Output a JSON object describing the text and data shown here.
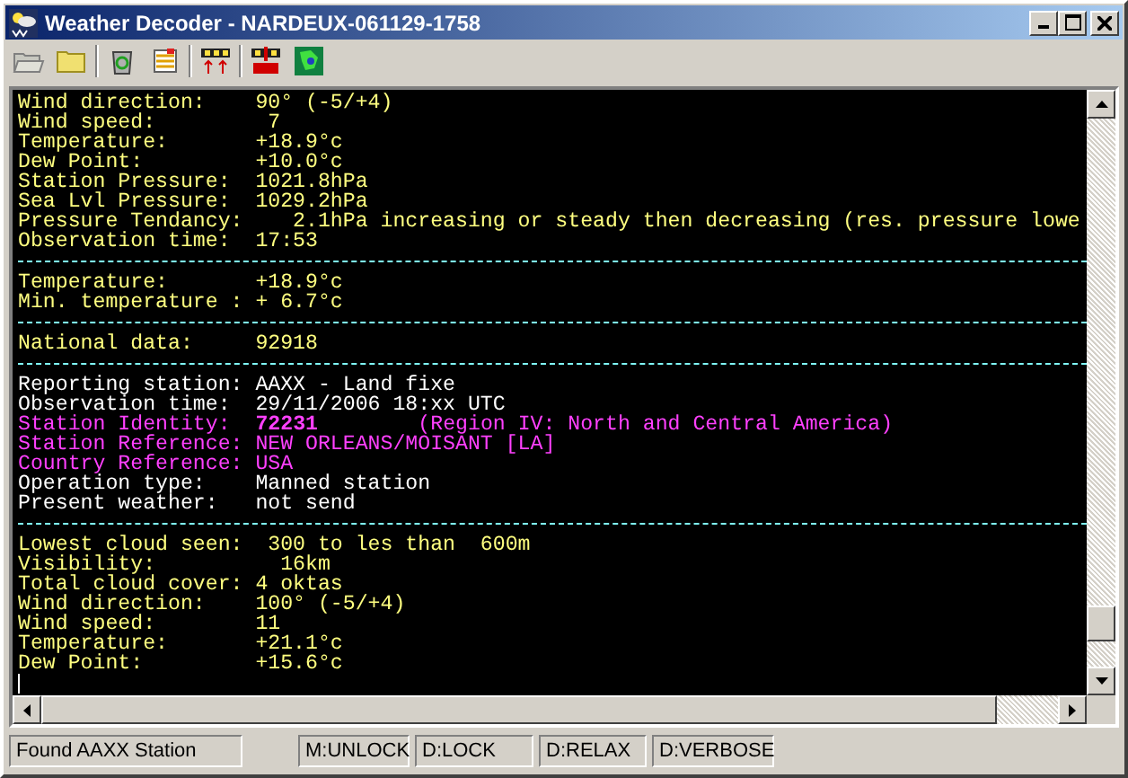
{
  "window": {
    "title": "Weather Decoder - NARDEUX-061129-1758"
  },
  "output": {
    "lines": [
      {
        "kind": "text",
        "color": "#ffff80",
        "text": "Wind direction:    90° (-5/+4)"
      },
      {
        "kind": "text",
        "color": "#ffff80",
        "text": "Wind speed:         7"
      },
      {
        "kind": "text",
        "color": "#ffff80",
        "text": "Temperature:       +18.9°c"
      },
      {
        "kind": "text",
        "color": "#ffff80",
        "text": "Dew Point:         +10.0°c"
      },
      {
        "kind": "text",
        "color": "#ffff80",
        "text": "Station Pressure:  1021.8hPa"
      },
      {
        "kind": "text",
        "color": "#ffff80",
        "text": "Sea Lvl Pressure:  1029.2hPa"
      },
      {
        "kind": "text",
        "color": "#ffff80",
        "text": "Pressure Tendancy:    2.1hPa increasing or steady then decreasing (res. pressure lowe"
      },
      {
        "kind": "text",
        "color": "#ffff80",
        "text": "Observation time:  17:53"
      },
      {
        "kind": "separator",
        "color": "#80ffff"
      },
      {
        "kind": "text",
        "color": "#ffff80",
        "text": "Temperature:       +18.9°c"
      },
      {
        "kind": "text",
        "color": "#ffff80",
        "text": "Min. temperature : + 6.7°c"
      },
      {
        "kind": "separator",
        "color": "#80ffff"
      },
      {
        "kind": "text",
        "color": "#ffff80",
        "text": "National data:     92918"
      },
      {
        "kind": "separator",
        "color": "#80ffff"
      },
      {
        "kind": "text",
        "color": "#ffffff",
        "text": "Reporting station: AAXX - Land fixe"
      },
      {
        "kind": "text",
        "color": "#ffffff",
        "text": "Observation time:  29/11/2006 18:xx UTC"
      },
      {
        "kind": "text",
        "color": "#ff40ff",
        "text": "Station Identity:  **72231**        (Region IV: North and Central America)"
      },
      {
        "kind": "text",
        "color": "#ff40ff",
        "text": "Station Reference: NEW ORLEANS/MOISANT [LA]"
      },
      {
        "kind": "text",
        "color": "#ff40ff",
        "text": "Country Reference: USA"
      },
      {
        "kind": "text",
        "color": "#ffffff",
        "text": "Operation type:    Manned station"
      },
      {
        "kind": "text",
        "color": "#ffffff",
        "text": "Present weather:   not send"
      },
      {
        "kind": "separator",
        "color": "#80ffff"
      },
      {
        "kind": "text",
        "color": "#ffff80",
        "text": "Lowest cloud seen:  300 to les than  600m"
      },
      {
        "kind": "text",
        "color": "#ffff80",
        "text": "Visibility:          16km"
      },
      {
        "kind": "text",
        "color": "#ffff80",
        "text": "Total cloud cover: 4 oktas"
      },
      {
        "kind": "text",
        "color": "#ffff80",
        "text": "Wind direction:    100° (-5/+4)"
      },
      {
        "kind": "text",
        "color": "#ffff80",
        "text": "Wind speed:        11"
      },
      {
        "kind": "text",
        "color": "#ffff80",
        "text": "Temperature:       +21.1°c"
      },
      {
        "kind": "text",
        "color": "#ffff80",
        "text": "Dew Point:         +15.6°c"
      }
    ]
  },
  "status_bar": {
    "message": "Found AAXX Station",
    "indicators": [
      "M:UNLOCK",
      "D:LOCK",
      "D:RELAX",
      "D:VERBOSE"
    ]
  }
}
